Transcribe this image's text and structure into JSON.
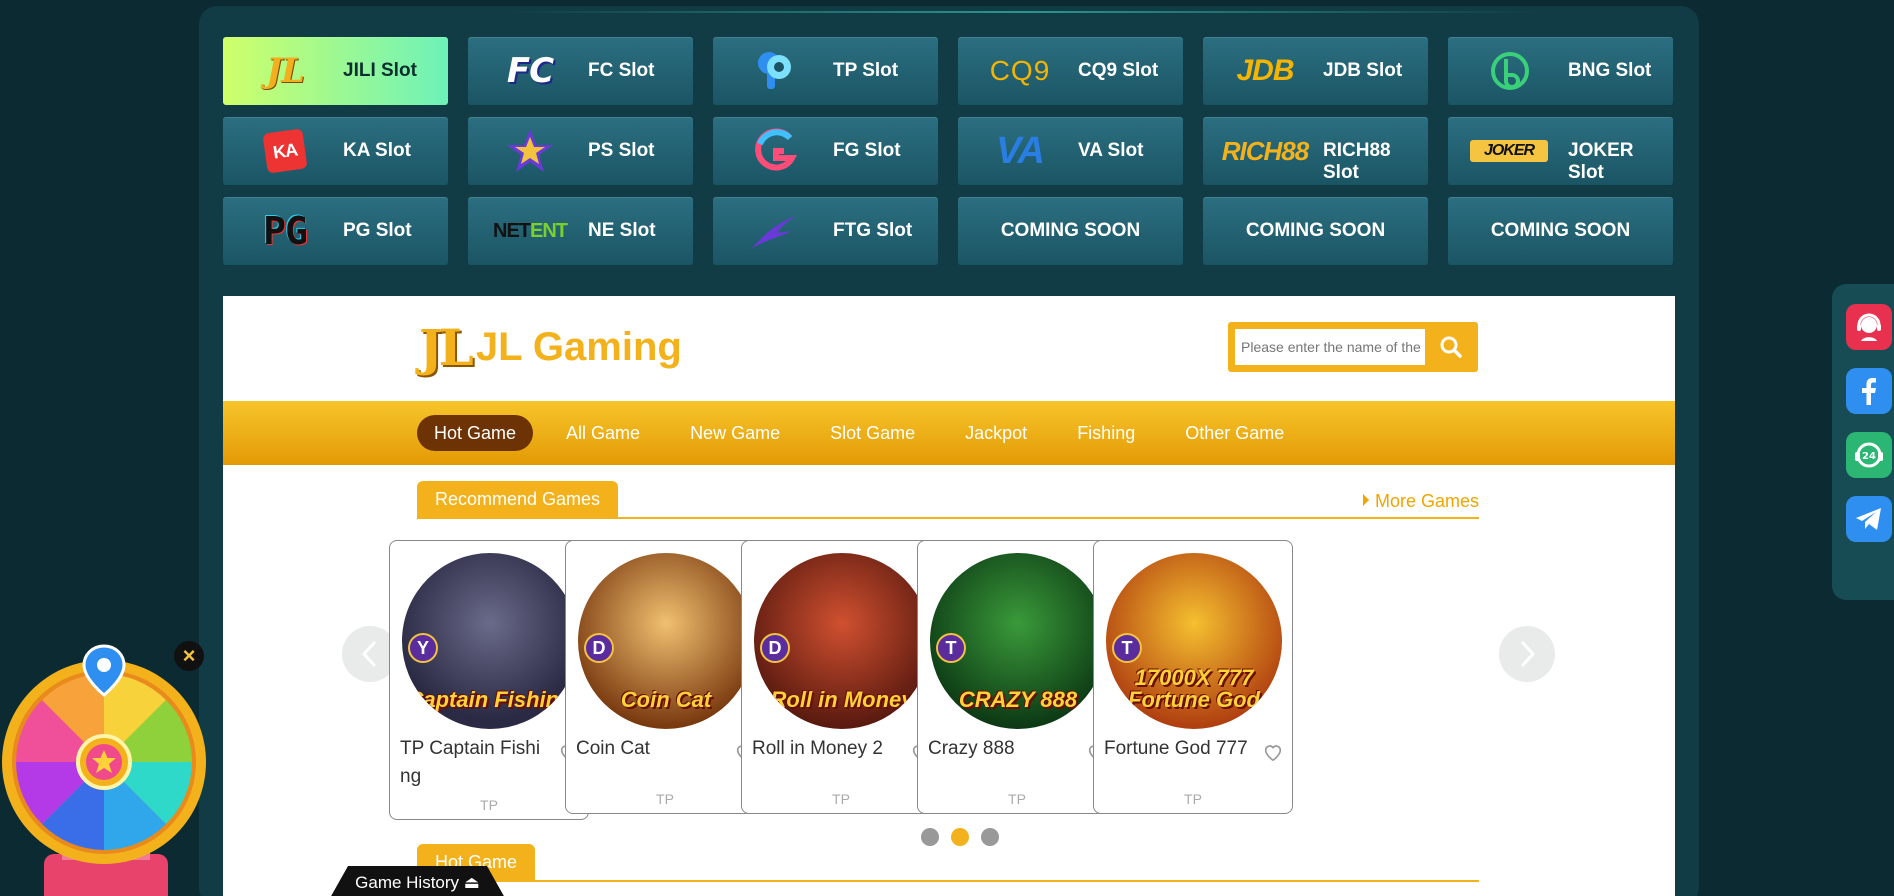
{
  "providers": [
    {
      "label": "JILI Slot",
      "logo": "JL",
      "logo_class": "lg-jl",
      "active": true
    },
    {
      "label": "FC Slot",
      "logo": "FC",
      "logo_class": "lg-fc"
    },
    {
      "label": "TP Slot",
      "logo": "",
      "logo_class": "lg-tp"
    },
    {
      "label": "CQ9 Slot",
      "logo": "CQ9",
      "logo_class": "lg-cq9"
    },
    {
      "label": "JDB Slot",
      "logo": "JDB",
      "logo_class": "lg-jdb"
    },
    {
      "label": "BNG Slot",
      "logo": "",
      "logo_class": "lg-bng"
    },
    {
      "label": "KA Slot",
      "logo": "KA",
      "logo_class": "lg-ka"
    },
    {
      "label": "PS Slot",
      "logo": "",
      "logo_class": "lg-ps"
    },
    {
      "label": "FG Slot",
      "logo": "",
      "logo_class": "lg-fg"
    },
    {
      "label": "VA Slot",
      "logo": "VA",
      "logo_class": "lg-va"
    },
    {
      "label": "RICH88 Slot",
      "logo": "RICH88",
      "logo_class": "lg-rich"
    },
    {
      "label": "JOKER Slot",
      "logo": "JOKER",
      "logo_class": "lg-joker"
    },
    {
      "label": "PG Slot",
      "logo": "PG",
      "logo_class": "lg-pg"
    },
    {
      "label": "NE Slot",
      "logo": "",
      "logo_class": "lg-net"
    },
    {
      "label": "FTG Slot",
      "logo": "",
      "logo_class": "lg-ftg"
    },
    {
      "label": "COMING SOON",
      "logo": "",
      "logo_class": "",
      "soon": true
    },
    {
      "label": "COMING SOON",
      "logo": "",
      "logo_class": "",
      "soon": true
    },
    {
      "label": "COMING SOON",
      "logo": "",
      "logo_class": "",
      "soon": true
    }
  ],
  "netent": {
    "a": "NET",
    "b": "ENT"
  },
  "site": {
    "logo_mark": "JL",
    "logo_text": "JL Gaming"
  },
  "search": {
    "placeholder": "Please enter the name of the game",
    "value": "Please enter the name of t"
  },
  "nav": [
    "Hot Game",
    "All Game",
    "New Game",
    "Slot Game",
    "Jackpot",
    "Fishing",
    "Other Game"
  ],
  "nav_active": 0,
  "recommend": {
    "title": "Recommend Games",
    "more": "More Games"
  },
  "games": [
    {
      "name": "TP Captain Fishing",
      "art": "Captain Fishing",
      "badge": "Y",
      "provider": "TP",
      "bg": "radial-gradient(circle at 50% 40%, #6a6a8a, #2a2a44 70%)"
    },
    {
      "name": "Coin Cat",
      "art": "Coin Cat",
      "badge": "D",
      "provider": "TP",
      "bg": "radial-gradient(circle at 50% 40%, #f0c070, #7a3a10 75%)"
    },
    {
      "name": "Roll in Money 2",
      "art": "Roll in Money",
      "badge": "D",
      "provider": "TP",
      "bg": "radial-gradient(circle at 50% 40%, #d05030, #5a1a10 75%)"
    },
    {
      "name": "Crazy 888",
      "art": "CRAZY 888",
      "badge": "T",
      "provider": "TP",
      "bg": "radial-gradient(circle at 50% 40%, #3a9a3a, #0d3a15 75%)"
    },
    {
      "name": "Fortune God 777",
      "art": "17000X 777 Fortune God",
      "badge": "T",
      "provider": "TP",
      "bg": "radial-gradient(circle at 50% 40%, #f5c030, #b04010 75%)"
    }
  ],
  "carousel": {
    "pages": 3,
    "active": 1
  },
  "hot": {
    "title": "Hot Game"
  },
  "widgets": {
    "close": "×",
    "game_history": "Game History ⏏"
  },
  "colors": {
    "accent": "#f3b21c",
    "nav_active": "#6e3305",
    "panel": "#113c45",
    "provider_btn": "#1f5d6d"
  },
  "floatbar": [
    "support-agent-icon",
    "facebook-icon",
    "24h-service-icon",
    "telegram-icon"
  ]
}
